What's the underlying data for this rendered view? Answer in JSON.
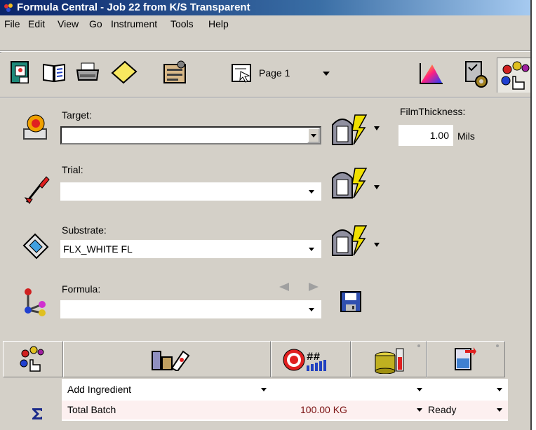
{
  "window": {
    "title": "Formula Central  -  Job 22 from K/S Transparent"
  },
  "menu": [
    "File",
    "Edit",
    "View",
    "Go",
    "Instrument",
    "Tools",
    "Help"
  ],
  "toolbar": {
    "page_label": "Page 1"
  },
  "target": {
    "label": "Target:",
    "value": ""
  },
  "trial": {
    "label": "Trial:",
    "value": ""
  },
  "substrate": {
    "label": "Substrate:",
    "value": "FLX_WHITE FL"
  },
  "formula": {
    "label": "Formula:",
    "value": ""
  },
  "film": {
    "label": "FilmThickness:",
    "value": "1.00",
    "unit": "Mils"
  },
  "grid": {
    "add_row": {
      "label": "Add Ingredient"
    },
    "total_row": {
      "label": "Total Batch",
      "amount": "100.00 KG",
      "status": "Ready"
    }
  },
  "colors": {
    "title_start": "#0a246a",
    "title_end": "#a6caf0",
    "chrome": "#d4d0c8",
    "total_row_bg": "#fdf0f0",
    "amount_text": "#7a1010"
  }
}
